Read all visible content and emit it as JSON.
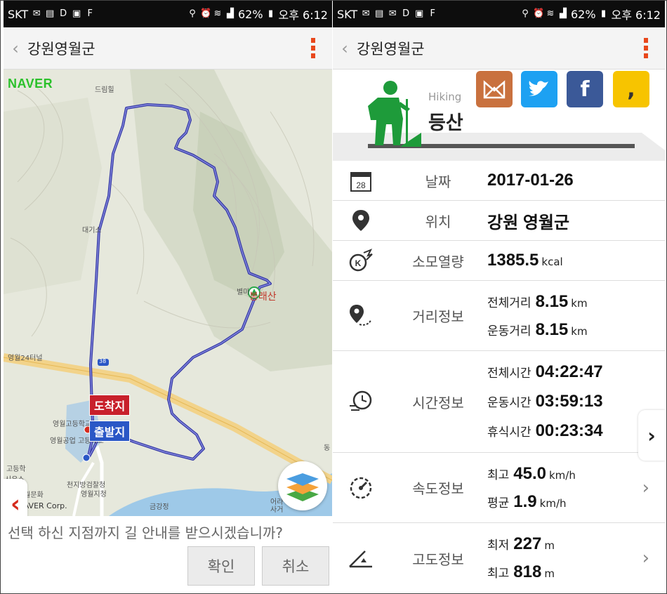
{
  "left": {
    "status": {
      "carrier": "SKT",
      "battery": "62%",
      "time": "오후 6:12"
    },
    "appbar": {
      "back": "‹",
      "title": "강원영월군"
    },
    "map": {
      "logo": "NAVER",
      "copyright": "© NAVER Corp.",
      "labels": [
        "드림힐",
        "대기소",
        "별마",
        "영월고등학교",
        "영월공업 고등학교",
        "고등학",
        "영월문화",
        "천지방검찰청",
        "영월지청",
        "금강정",
        "시우스",
        "어라",
        "사거",
        "동",
        "영월24터널",
        "38"
      ],
      "peak_label": "봉래산",
      "end_pin": "도착지",
      "start_pin": "출발지",
      "nav_prev": "‹"
    },
    "prompt": {
      "question": "선택 하신 지점까지 길 안내를 받으시겠습니까?",
      "confirm": "확인",
      "cancel": "취소"
    }
  },
  "right": {
    "status": {
      "carrier": "SKT",
      "battery": "62%",
      "time": "오후 6:12"
    },
    "appbar": {
      "back": "‹",
      "title": "강원영월군"
    },
    "activity": {
      "en": "Hiking",
      "ko": "등산"
    },
    "share": [
      "kakaostory",
      "twitter",
      "facebook",
      "kakaotalk"
    ],
    "rows": {
      "date": {
        "label": "날짜",
        "value": "2017-01-26",
        "icon_text": "28"
      },
      "location": {
        "label": "위치",
        "value": "강원 영월군"
      },
      "calories": {
        "label": "소모열량",
        "value": "1385.5",
        "unit": "kcal"
      },
      "distance": {
        "label": "거리정보",
        "total_label": "전체거리",
        "total": "8.15",
        "moving_label": "운동거리",
        "moving": "8.15",
        "unit": "km"
      },
      "time": {
        "label": "시간정보",
        "total_label": "전체시간",
        "total": "04:22:47",
        "moving_label": "운동시간",
        "moving": "03:59:13",
        "rest_label": "휴식시간",
        "rest": "00:23:34"
      },
      "speed": {
        "label": "속도정보",
        "max_label": "최고",
        "max": "45.0",
        "avg_label": "평균",
        "avg": "1.9",
        "unit": "km/h"
      },
      "altitude": {
        "label": "고도정보",
        "min_label": "최저",
        "min": "227",
        "max_label": "최고",
        "max": "818",
        "unit": "m"
      }
    },
    "nav_next": "›"
  },
  "colors": {
    "accent": "#e8481c",
    "route": "#3b3fa8",
    "end_pin": "#c8202b",
    "start_pin": "#2a57c6",
    "hiker": "#1e9b3a"
  }
}
